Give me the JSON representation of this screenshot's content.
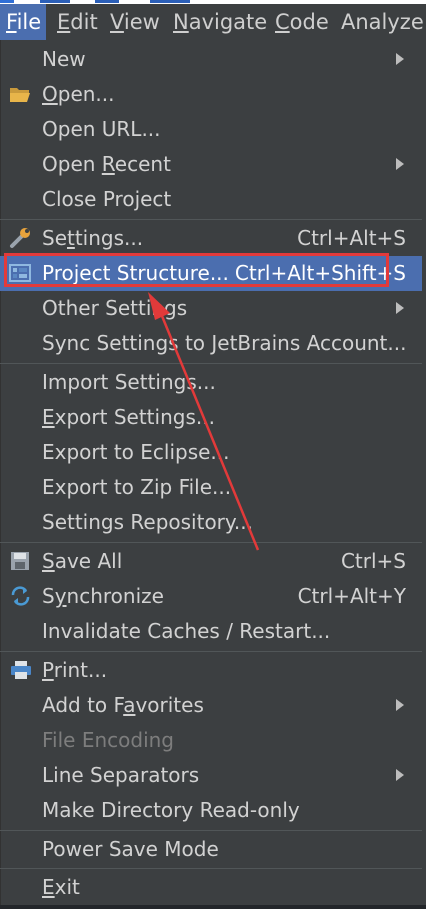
{
  "menubar": {
    "items": [
      {
        "mnemonic": "F",
        "rest": "ile"
      },
      {
        "mnemonic": "E",
        "rest": "dit"
      },
      {
        "mnemonic": "V",
        "rest": "iew"
      },
      {
        "mnemonic": "N",
        "rest": "avigate"
      },
      {
        "mnemonic": "C",
        "rest": "ode"
      },
      {
        "label": "Analyze"
      }
    ]
  },
  "file_menu": {
    "new": {
      "label": "New"
    },
    "open": {
      "mn": "O",
      "rest": "pen..."
    },
    "open_url": {
      "label": "Open URL..."
    },
    "open_recent": {
      "pre": "Open ",
      "mn": "R",
      "rest": "ecent"
    },
    "close_project": {
      "label": "Close Project"
    },
    "settings": {
      "pre": "Se",
      "mn": "t",
      "rest": "tings...",
      "shortcut": "Ctrl+Alt+S"
    },
    "project_structure": {
      "label": "Project Structure...",
      "shortcut": "Ctrl+Alt+Shift+S"
    },
    "other_settings": {
      "label": "Other Settings"
    },
    "sync_settings": {
      "label": "Sync Settings to JetBrains Account..."
    },
    "import_settings": {
      "label": "Import Settings..."
    },
    "export_settings": {
      "mn": "E",
      "rest": "xport Settings..."
    },
    "export_eclipse": {
      "label": "Export to Eclipse..."
    },
    "export_zip": {
      "label": "Export to Zip File..."
    },
    "settings_repo": {
      "label": "Settings Repository..."
    },
    "save_all": {
      "mn": "S",
      "rest": "ave All",
      "shortcut": "Ctrl+S"
    },
    "synchronize": {
      "pre": "S",
      "mn": "y",
      "rest": "nchronize",
      "shortcut": "Ctrl+Alt+Y"
    },
    "invalidate": {
      "label": "Invalidate Caches / Restart..."
    },
    "print": {
      "mn": "P",
      "rest": "rint..."
    },
    "favorites": {
      "pre": "Add to F",
      "mn": "a",
      "rest": "vorites"
    },
    "file_encoding": {
      "label": "File Encoding"
    },
    "line_separators": {
      "label": "Line Separators"
    },
    "make_readonly": {
      "label": "Make Directory Read-only"
    },
    "power_save": {
      "label": "Power Save Mode"
    },
    "exit": {
      "mn": "E",
      "rest": "xit"
    }
  },
  "colors": {
    "menu_bg": "#3c3f41",
    "highlight": "#4b6eaf",
    "annotation_red": "#e23a3a"
  }
}
